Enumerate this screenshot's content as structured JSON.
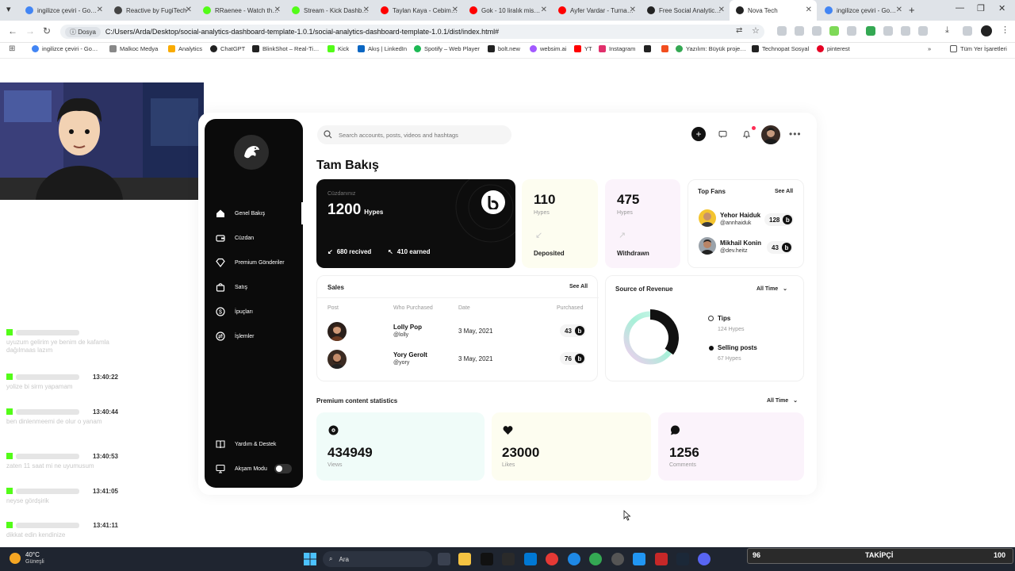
{
  "browser": {
    "tabs": [
      {
        "label": "ingilizce çeviri - Go…",
        "color": "#4285f4"
      },
      {
        "label": "Reactive by FugiTech",
        "color": "#444444"
      },
      {
        "label": "RRaenee - Watch th…",
        "color": "#53fc18"
      },
      {
        "label": "Stream - Kick Dashb…",
        "color": "#53fc18"
      },
      {
        "label": "Taylan Kaya - Cebim…",
        "color": "#ff0000"
      },
      {
        "label": "Gok - 10 liralık mis…",
        "color": "#ff0000"
      },
      {
        "label": "Ayfer Vardar - Turna…",
        "color": "#ff0000"
      },
      {
        "label": "Free Social Analytic…",
        "color": "#222222"
      },
      {
        "label": "Nova Tech",
        "color": "#222222"
      },
      {
        "label": "ingilizce çeviri - Go…",
        "color": "#4285f4"
      }
    ],
    "address_chip": "Dosya",
    "url": "C:/Users/Arda/Desktop/social-analytics-dashboard-template-1.0.1/social-analytics-dashboard-template-1.0.1/dist/index.html#",
    "bookmarks": [
      {
        "label": "ingilizce çeviri - Go…",
        "color": "#4285f4"
      },
      {
        "label": "Malkoc Medya",
        "color": "#888888"
      },
      {
        "label": "Analytics",
        "color": "#f9ab00"
      },
      {
        "label": "ChatGPT",
        "color": "#222222"
      },
      {
        "label": "BlinkShot – Real-Ti…",
        "color": "#222222"
      },
      {
        "label": "Kick",
        "color": "#53fc18"
      },
      {
        "label": "Akış | LinkedIn",
        "color": "#0a66c2"
      },
      {
        "label": "Spotify – Web Player",
        "color": "#1db954"
      },
      {
        "label": "bolt.new",
        "color": "#222222"
      },
      {
        "label": "websim.ai",
        "color": "#a259ff"
      },
      {
        "label": "YT",
        "color": "#ff0000"
      },
      {
        "label": "Instagram",
        "color": "#e1306c"
      },
      {
        "label": "",
        "color": "#222222"
      },
      {
        "label": "",
        "color": "#f24e1e"
      },
      {
        "label": "Yazılım: Büyük proje…",
        "color": "#34a853"
      },
      {
        "label": "Technopat Sosyal",
        "color": "#222222"
      },
      {
        "label": "pinterest",
        "color": "#e60023"
      }
    ],
    "all_bookmarks": "Tüm Yer İşaretleri"
  },
  "chat": {
    "messages": [
      {
        "time": "",
        "text": "uyuzum gelirim ye benim de kafamla dağılmaas lazım"
      },
      {
        "time": "13:40:22",
        "text": "yolize bi sirm yapamam"
      },
      {
        "time": "13:40:44",
        "text": "ben dinlenmeemi de olur o yanam"
      },
      {
        "time": "13:40:53",
        "text": "zaten 11 saat mi ne uyumusum"
      },
      {
        "time": "13:41:05",
        "text": "neyse gördşirik"
      },
      {
        "time": "13:41:11",
        "text": "dikkat edin kendinize"
      }
    ]
  },
  "sidebar": {
    "items": [
      {
        "label": "Genel Bakış",
        "icon": "home-icon"
      },
      {
        "label": "Cüzdan",
        "icon": "wallet-icon"
      },
      {
        "label": "Premium Gönderiler",
        "icon": "diamond-icon"
      },
      {
        "label": "Satış",
        "icon": "bag-icon"
      },
      {
        "label": "İpuçları",
        "icon": "dollar-icon"
      },
      {
        "label": "İşlemler",
        "icon": "exchange-icon"
      }
    ],
    "help": "Yardım & Destek",
    "dark_mode": "Akşam Modu"
  },
  "header": {
    "search_placeholder": "Search accounts, posts, videos and hashtags"
  },
  "page_title": "Tam Bakış",
  "wallet": {
    "label": "Cüzdanınız",
    "amount": "1200",
    "unit": "Hypes",
    "received": "680 recived",
    "earned": "410 earned"
  },
  "deposited": {
    "value": "110",
    "unit": "Hypes",
    "label": "Deposited",
    "bg": "#fdfdf0"
  },
  "withdrawn": {
    "value": "475",
    "unit": "Hypes",
    "label": "Withdrawn",
    "bg": "#fbf3fb"
  },
  "top_fans": {
    "title": "Top Fans",
    "see_all": "See All",
    "fans": [
      {
        "name": "Yehor Haiduk",
        "handle": "@annhaiduk",
        "count": "128"
      },
      {
        "name": "Mikhail Konin",
        "handle": "@dev.heitz",
        "count": "43"
      }
    ]
  },
  "sales": {
    "title": "Sales",
    "see_all": "See All",
    "columns": [
      "Post",
      "Who Purchased",
      "Date",
      "Purchased"
    ],
    "rows": [
      {
        "name": "Lolly Pop",
        "handle": "@lolly",
        "date": "3 May, 2021",
        "count": "43"
      },
      {
        "name": "Yory Gerolt",
        "handle": "@yory",
        "date": "3 May, 2021",
        "count": "76"
      }
    ]
  },
  "revenue": {
    "title": "Source of Revenue",
    "filter": "All Time",
    "items": [
      {
        "label": "Tips",
        "value": "124 Hypes"
      },
      {
        "label": "Selling posts",
        "value": "67 Hypes"
      }
    ],
    "tips": 124,
    "selling": 67
  },
  "premium": {
    "title": "Premium content statistics",
    "filter": "All Time",
    "stats": [
      {
        "value": "434949",
        "label": "Views",
        "bg": "#f0fcf9",
        "icon": "eye-icon"
      },
      {
        "value": "23000",
        "label": "Likes",
        "bg": "#fdfdf0",
        "icon": "heart-icon"
      },
      {
        "value": "1256",
        "label": "Comments",
        "bg": "#fbf3fb",
        "icon": "comment-icon"
      }
    ]
  },
  "taskbar": {
    "weather_temp": "40°C",
    "weather_desc": "Güneşli",
    "search": "Ara",
    "follower_left": "96",
    "follower_label": "TAKİPÇİ",
    "follower_right": "100"
  }
}
